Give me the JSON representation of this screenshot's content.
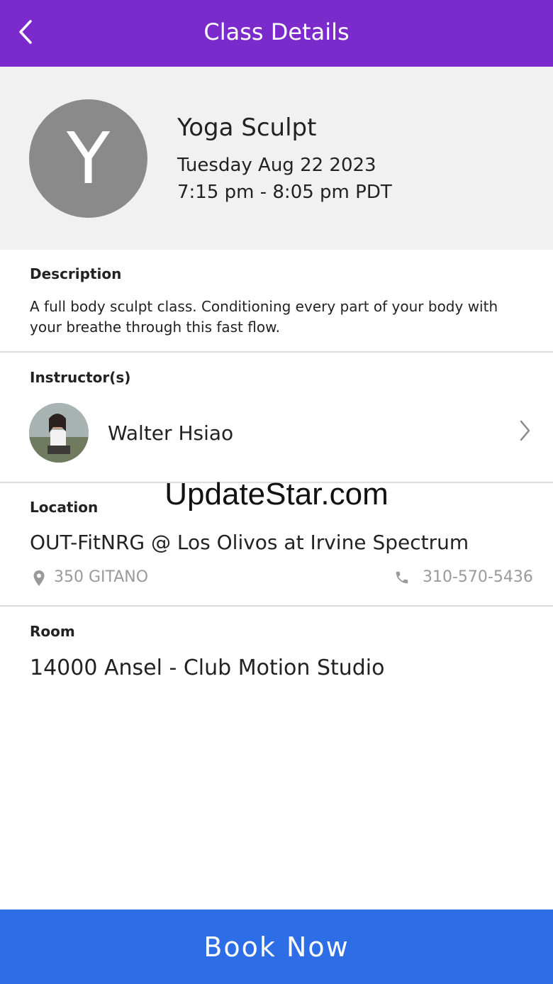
{
  "header": {
    "title": "Class Details",
    "back_icon": "chevron-left-icon"
  },
  "class_info": {
    "avatar_letter": "Y",
    "name": "Yoga Sculpt",
    "date": "Tuesday Aug 22 2023",
    "time": "7:15 pm - 8:05 pm PDT"
  },
  "description": {
    "label": "Description",
    "text": "A full body sculpt class. Conditioning every part of your body with your breathe through this fast flow."
  },
  "instructors": {
    "label": "Instructor(s)",
    "items": [
      {
        "name": "Walter Hsiao",
        "avatar_icon": "instructor-photo"
      }
    ]
  },
  "watermark": "UpdateStar.com",
  "location": {
    "label": "Location",
    "name": "OUT-FitNRG @ Los Olivos at Irvine Spectrum",
    "address": "350 GITANO",
    "phone": "310-570-5436"
  },
  "room": {
    "label": "Room",
    "name": "14000 Ansel - Club Motion Studio"
  },
  "actions": {
    "book_label": "Book Now"
  },
  "colors": {
    "header": "#7b2bcc",
    "book_button": "#2d6de6",
    "hero_bg": "#f1f1f1",
    "avatar_bg": "#8a8a8a",
    "muted_text": "#9a9a9a"
  }
}
